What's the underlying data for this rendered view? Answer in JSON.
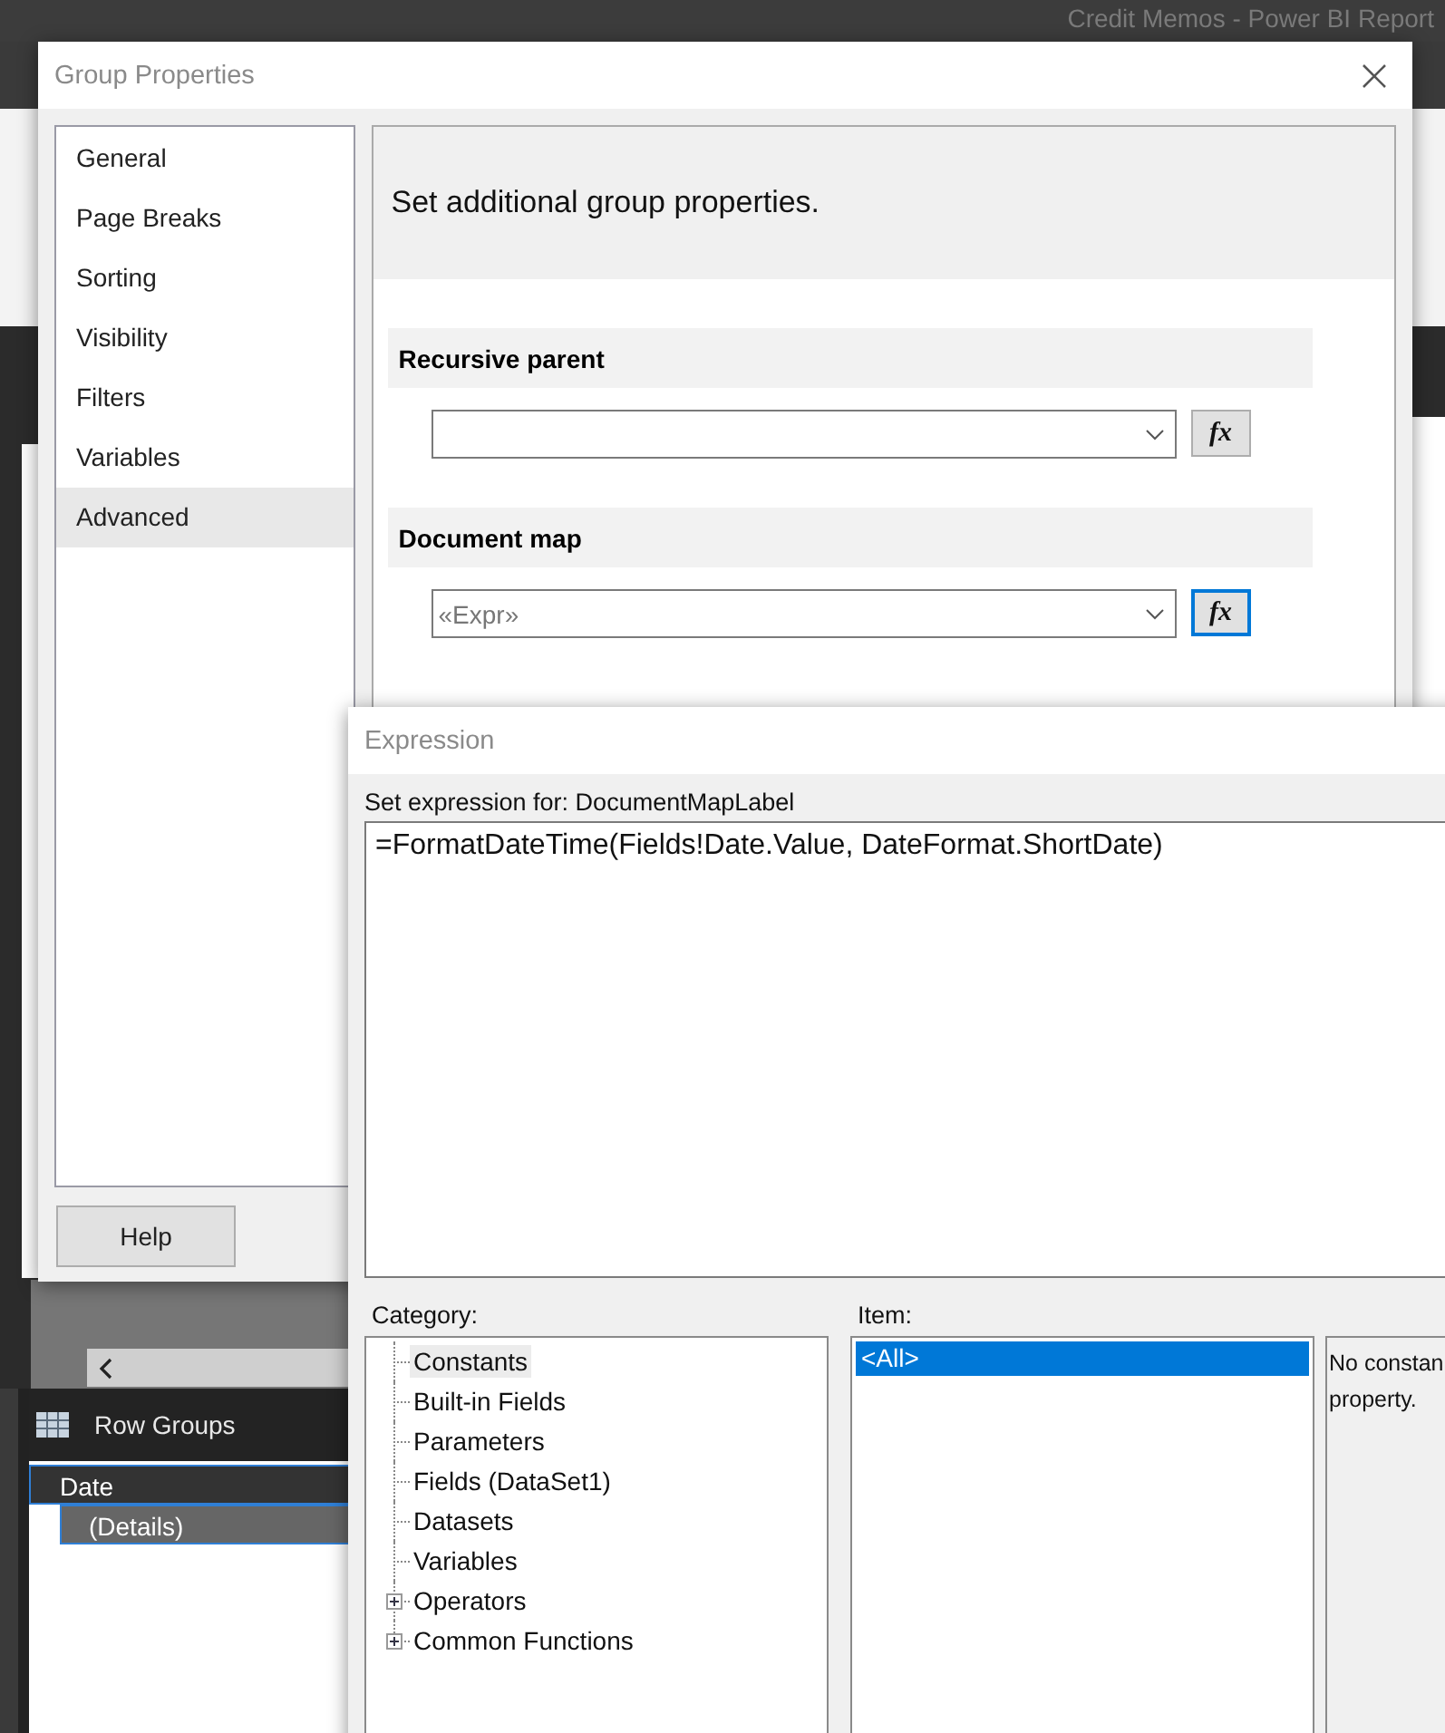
{
  "app_window": {
    "title": "Credit Memos - Power BI Report"
  },
  "group_properties": {
    "title": "Group Properties",
    "nav": [
      {
        "label": "General",
        "selected": false
      },
      {
        "label": "Page Breaks",
        "selected": false
      },
      {
        "label": "Sorting",
        "selected": false
      },
      {
        "label": "Visibility",
        "selected": false
      },
      {
        "label": "Filters",
        "selected": false
      },
      {
        "label": "Variables",
        "selected": false
      },
      {
        "label": "Advanced",
        "selected": true
      }
    ],
    "help_button": "Help",
    "heading": "Set additional group properties.",
    "sections": [
      {
        "title": "Recursive parent",
        "button_label": "fx",
        "button_focused": false
      },
      {
        "title": "Document map",
        "value": "«Expr»",
        "button_label": "fx",
        "button_focused": true
      }
    ]
  },
  "expression": {
    "title": "Expression",
    "prompt": "Set expression for: DocumentMapLabel",
    "text": "=FormatDateTime(Fields!Date.Value, DateFormat.ShortDate)",
    "category_label": "Category:",
    "categories": [
      {
        "label": "Constants",
        "kind": "leaf",
        "selected": true
      },
      {
        "label": "Built-in Fields",
        "kind": "leaf",
        "selected": false
      },
      {
        "label": "Parameters",
        "kind": "leaf",
        "selected": false
      },
      {
        "label": "Fields (DataSet1)",
        "kind": "leaf",
        "selected": false
      },
      {
        "label": "Datasets",
        "kind": "leaf",
        "selected": false
      },
      {
        "label": "Variables",
        "kind": "leaf",
        "selected": false
      },
      {
        "label": "Operators",
        "kind": "group",
        "selected": false
      },
      {
        "label": "Common Functions",
        "kind": "group",
        "selected": false
      }
    ],
    "item_label": "Item:",
    "items": [
      {
        "label": "<All>",
        "selected": true
      }
    ],
    "description_lines": [
      "No constan",
      "property."
    ]
  },
  "row_groups": {
    "title": "Row Groups",
    "groups": [
      {
        "label": "Date",
        "selected": true,
        "children": [
          {
            "label": "(Details)",
            "selected": true
          }
        ]
      }
    ]
  }
}
